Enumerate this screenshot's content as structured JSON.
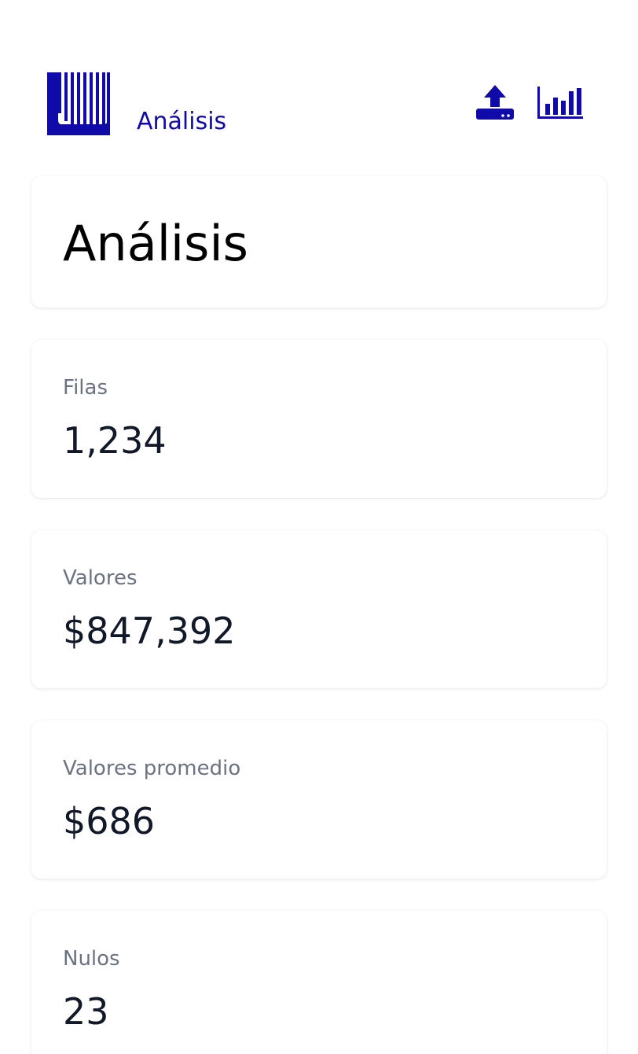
{
  "header": {
    "brand_label": "Análisis",
    "logo_icon": "barcode-logo-icon",
    "actions": [
      {
        "icon": "upload-icon",
        "label": "upload"
      },
      {
        "icon": "bar-chart-icon",
        "label": "analytics"
      }
    ]
  },
  "page": {
    "title": "Análisis"
  },
  "stats": [
    {
      "label": "Filas",
      "value": "1,234"
    },
    {
      "label": "Valores",
      "value": "$847,392"
    },
    {
      "label": "Valores promedio",
      "value": "$686"
    },
    {
      "label": "Nulos",
      "value": "23"
    }
  ],
  "colors": {
    "accent": "#0f0aa8",
    "label": "#6b7280",
    "value": "#111827"
  }
}
